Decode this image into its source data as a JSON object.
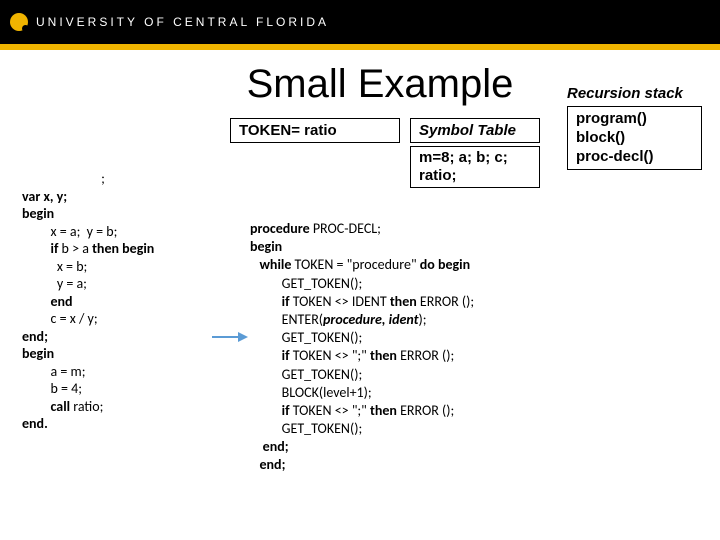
{
  "header": {
    "university": "UNIVERSITY OF CENTRAL FLORIDA"
  },
  "title": "Small Example",
  "boxes": {
    "token": "TOKEN= ratio",
    "symbol_title": "Symbol Table",
    "symbol_content": "m=8; a; b; c; ratio;"
  },
  "recursion": {
    "title": "Recursion stack",
    "items": [
      "program()",
      "block()",
      "proc-decl()"
    ]
  },
  "left_code": {
    "l0": ";",
    "l1": "var x, y;",
    "l2": "begin",
    "l3": "x = a;  y = b;",
    "l4a": "if ",
    "l4b": "b > a ",
    "l4c": "then begin",
    "l5": "x = b;",
    "l6": "y = a;",
    "l7": "end",
    "l8": "c = x / y;",
    "l9": "end;",
    "l10": "begin",
    "l11": "a = m;",
    "l12": "b = 4;",
    "l13a": "call ",
    "l13b": "ratio;",
    "l14": "end."
  },
  "right_code": {
    "l0a": "procedure ",
    "l0b": "PROC-DECL;",
    "l1": "begin",
    "l2a": "while",
    "l2b": " TOKEN = \"procedure\" ",
    "l2c": "do begin",
    "l3": "GET_TOKEN();",
    "l4a": "if ",
    "l4b": "TOKEN <> IDENT ",
    "l4c": "then ",
    "l4d": "ERROR ();",
    "l5a": "ENTER(",
    "l5b": "procedure, ident",
    "l5c": ");",
    "l6": "GET_TOKEN();",
    "l7a": "if ",
    "l7b": "TOKEN <> \";\" ",
    "l7c": "then ",
    "l7d": "ERROR ();",
    "l8": "GET_TOKEN();",
    "l9": "BLOCK(level+1);",
    "l10a": "if ",
    "l10b": "TOKEN <> \";\" ",
    "l10c": "then ",
    "l10d": "ERROR ();",
    "l11": "GET_TOKEN();",
    "l12": "end;",
    "l13": "end;"
  }
}
